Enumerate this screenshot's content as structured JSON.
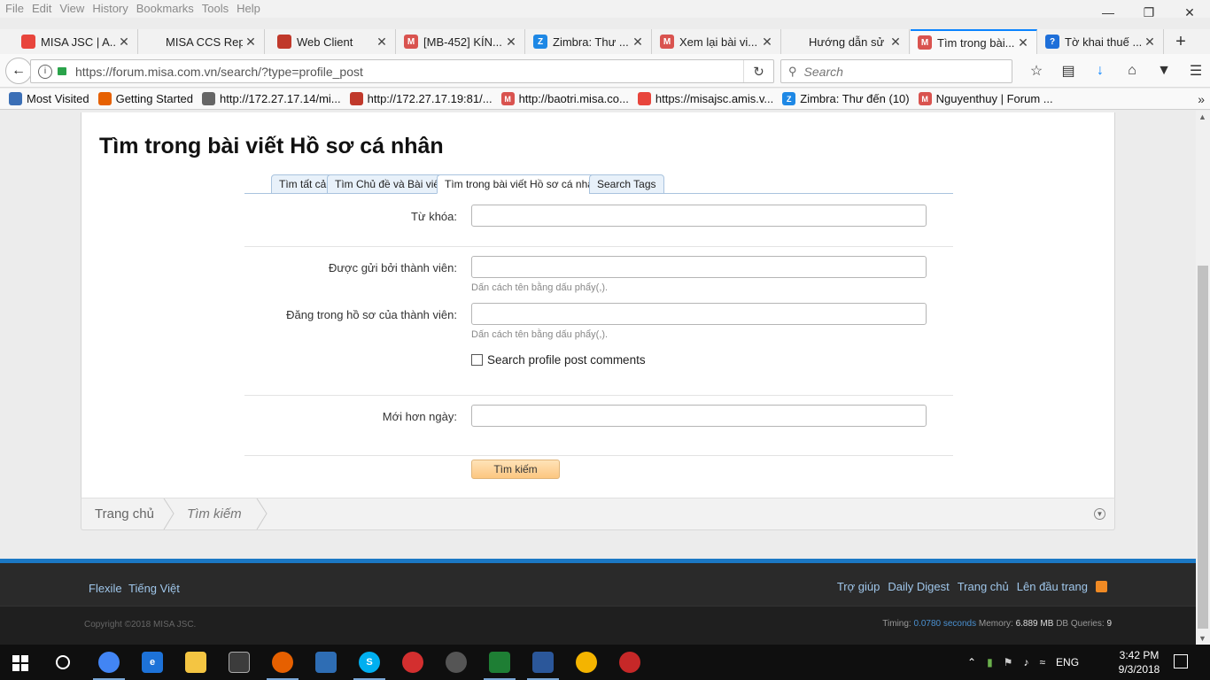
{
  "menubar": {
    "items": [
      "File",
      "Edit",
      "View",
      "History",
      "Bookmarks",
      "Tools",
      "Help"
    ]
  },
  "window_controls": {
    "minimize": "—",
    "restore": "❐",
    "close": "✕"
  },
  "tabs": [
    {
      "label": "MISA JSC | A...",
      "icon_color": "#e8453c"
    },
    {
      "label": "MISA CCS Report",
      "icon_color": "#f2f2f2"
    },
    {
      "label": "Web Client",
      "icon_color": "#c0392b"
    },
    {
      "label": "[MB-452] KÍN...",
      "icon_color": "#d9534f"
    },
    {
      "label": "Zimbra: Thư ...",
      "icon_color": "#1e88e5"
    },
    {
      "label": "Xem lại bài vi...",
      "icon_color": "#d9534f"
    },
    {
      "label": "Hướng dẫn sử dụ...",
      "icon_color": "#f2f2f2"
    },
    {
      "label": "Tìm trong bài...",
      "icon_color": "#d9534f"
    },
    {
      "label": "Tờ khai thuế ...",
      "icon_color": "#1e6fd9"
    }
  ],
  "new_tab": "+",
  "nav": {
    "url": "https://forum.misa.com.vn/search/?type=profile_post",
    "search_placeholder": "Search"
  },
  "bookmarks": [
    {
      "label": "Most Visited",
      "icon_color": "#3b6fb6"
    },
    {
      "label": "Getting Started",
      "icon_color": "#e66000"
    },
    {
      "label": "http://172.27.17.14/mi...",
      "icon_color": "#666666"
    },
    {
      "label": "http://172.27.17.19:81/...",
      "icon_color": "#c0392b"
    },
    {
      "label": "http://baotri.misa.co...",
      "icon_color": "#d9534f"
    },
    {
      "label": "https://misajsc.amis.v...",
      "icon_color": "#e8453c"
    },
    {
      "label": "Zimbra: Thư đến (10)",
      "icon_color": "#1e88e5"
    },
    {
      "label": "Nguyenthuy | Forum ...",
      "icon_color": "#d9534f"
    }
  ],
  "page": {
    "title": "Tìm trong bài viết Hồ sơ cá nhân",
    "search_tabs": [
      {
        "label": "Tìm tất cả"
      },
      {
        "label": "Tìm Chủ đề và Bài viết"
      },
      {
        "label": "Tìm trong bài viết Hồ sơ cá nhân"
      },
      {
        "label": "Search Tags"
      }
    ],
    "fields": {
      "keyword_label": "Từ khóa:",
      "posted_by_label": "Được gửi bởi thành viên:",
      "posted_by_hint": "Dấn cách tên bằng dấu phẩy(,).",
      "profile_of_label": "Đăng trong hồ sơ của thành viên:",
      "profile_of_hint": "Dấn cách tên bằng dấu phẩy(,).",
      "comments_checkbox": "Search profile post comments",
      "newer_than_label": "Mới hơn ngày:"
    },
    "submit_label": "Tìm kiếm"
  },
  "breadcrumb": {
    "home": "Trang chủ",
    "current": "Tìm kiếm"
  },
  "footer": {
    "style_link": "Flexile",
    "language_link": "Tiếng Việt",
    "links": [
      "Trợ giúp",
      "Daily Digest",
      "Trang chủ",
      "Lên đầu trang"
    ],
    "copyright": "Copyright ©2018 MISA JSC.",
    "timing_label": "Timing:",
    "timing_value": "0.0780 seconds",
    "memory_label": "Memory:",
    "memory_value": "6.889 MB",
    "queries_label": "DB Queries:",
    "queries_value": "9"
  },
  "taskbar": {
    "language": "ENG",
    "time": "3:42 PM",
    "date": "9/3/2018"
  }
}
